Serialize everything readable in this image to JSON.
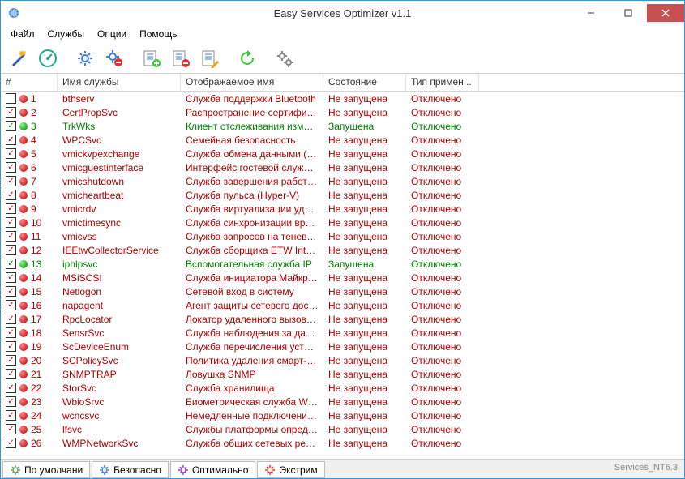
{
  "window": {
    "title": "Easy Services Optimizer v1.1"
  },
  "menu": {
    "file": "Файл",
    "services": "Службы",
    "options": "Опции",
    "help": "Помощь"
  },
  "columns": {
    "num": "#",
    "name": "Имя службы",
    "display": "Отображаемое имя",
    "state": "Состояние",
    "startup": "Тип примен..."
  },
  "tabs": {
    "default": "По умолчани",
    "safe": "Безопасно",
    "optimal": "Оптимально",
    "extreme": "Экстрим"
  },
  "status": {
    "right": "Services_NT6.3"
  },
  "rows": [
    {
      "n": "1",
      "chk": false,
      "dot": "red",
      "name": "bthserv",
      "disp": "Служба поддержки Bluetooth",
      "state": "Не запущена",
      "start": "Отключено",
      "cls": "red-text"
    },
    {
      "n": "2",
      "chk": true,
      "dot": "red",
      "name": "CertPropSvc",
      "disp": "Распространение сертификата",
      "state": "Не запущена",
      "start": "Отключено",
      "cls": "red-text"
    },
    {
      "n": "3",
      "chk": true,
      "dot": "green",
      "name": "TrkWks",
      "disp": "Клиент отслеживания измени...",
      "state": "Запущена",
      "start": "Отключено",
      "cls": "green-text"
    },
    {
      "n": "4",
      "chk": true,
      "dot": "red",
      "name": "WPCSvc",
      "disp": "Семейная безопасность",
      "state": "Не запущена",
      "start": "Отключено",
      "cls": "red-text"
    },
    {
      "n": "5",
      "chk": true,
      "dot": "red",
      "name": "vmickvpexchange",
      "disp": "Служба обмена данными (Hy...",
      "state": "Не запущена",
      "start": "Отключено",
      "cls": "red-text"
    },
    {
      "n": "6",
      "chk": true,
      "dot": "red",
      "name": "vmicguestinterface",
      "disp": "Интерфейс гостевой службы ...",
      "state": "Не запущена",
      "start": "Отключено",
      "cls": "red-text"
    },
    {
      "n": "7",
      "chk": true,
      "dot": "red",
      "name": "vmicshutdown",
      "disp": "Служба завершения работы ...",
      "state": "Не запущена",
      "start": "Отключено",
      "cls": "red-text"
    },
    {
      "n": "8",
      "chk": true,
      "dot": "red",
      "name": "vmicheartbeat",
      "disp": "Служба пульса (Hyper-V)",
      "state": "Не запущена",
      "start": "Отключено",
      "cls": "red-text"
    },
    {
      "n": "9",
      "chk": true,
      "dot": "red",
      "name": "vmicrdv",
      "disp": "Служба виртуализации удал...",
      "state": "Не запущена",
      "start": "Отключено",
      "cls": "red-text"
    },
    {
      "n": "10",
      "chk": true,
      "dot": "red",
      "name": "vmictimesync",
      "disp": "Служба синхронизации време...",
      "state": "Не запущена",
      "start": "Отключено",
      "cls": "red-text"
    },
    {
      "n": "11",
      "chk": true,
      "dot": "red",
      "name": "vmicvss",
      "disp": "Служба запросов на теневое ...",
      "state": "Не запущена",
      "start": "Отключено",
      "cls": "red-text"
    },
    {
      "n": "12",
      "chk": true,
      "dot": "red",
      "name": "IEEtwCollectorService",
      "disp": "Служба сборщика ETW Intern...",
      "state": "Не запущена",
      "start": "Отключено",
      "cls": "red-text"
    },
    {
      "n": "13",
      "chk": true,
      "dot": "green",
      "name": "iphlpsvc",
      "disp": "Вспомогательная служба IP",
      "state": "Запущена",
      "start": "Отключено",
      "cls": "green-text"
    },
    {
      "n": "14",
      "chk": true,
      "dot": "red",
      "name": "MSiSCSI",
      "disp": "Служба инициатора Майкрос...",
      "state": "Не запущена",
      "start": "Отключено",
      "cls": "red-text"
    },
    {
      "n": "15",
      "chk": true,
      "dot": "red",
      "name": "Netlogon",
      "disp": "Сетевой вход в систему",
      "state": "Не запущена",
      "start": "Отключено",
      "cls": "red-text"
    },
    {
      "n": "16",
      "chk": true,
      "dot": "red",
      "name": "napagent",
      "disp": "Агент защиты сетевого дост...",
      "state": "Не запущена",
      "start": "Отключено",
      "cls": "red-text"
    },
    {
      "n": "17",
      "chk": true,
      "dot": "red",
      "name": "RpcLocator",
      "disp": "Локатор удаленного вызова ...",
      "state": "Не запущена",
      "start": "Отключено",
      "cls": "red-text"
    },
    {
      "n": "18",
      "chk": true,
      "dot": "red",
      "name": "SensrSvc",
      "disp": "Служба наблюдения за датч...",
      "state": "Не запущена",
      "start": "Отключено",
      "cls": "red-text"
    },
    {
      "n": "19",
      "chk": true,
      "dot": "red",
      "name": "ScDeviceEnum",
      "disp": "Служба перечисления устрой...",
      "state": "Не запущена",
      "start": "Отключено",
      "cls": "red-text"
    },
    {
      "n": "20",
      "chk": true,
      "dot": "red",
      "name": "SCPolicySvc",
      "disp": "Политика удаления смарт-карт",
      "state": "Не запущена",
      "start": "Отключено",
      "cls": "red-text"
    },
    {
      "n": "21",
      "chk": true,
      "dot": "red",
      "name": "SNMPTRAP",
      "disp": "Ловушка SNMP",
      "state": "Не запущена",
      "start": "Отключено",
      "cls": "red-text"
    },
    {
      "n": "22",
      "chk": true,
      "dot": "red",
      "name": "StorSvc",
      "disp": "Служба хранилища",
      "state": "Не запущена",
      "start": "Отключено",
      "cls": "red-text"
    },
    {
      "n": "23",
      "chk": true,
      "dot": "red",
      "name": "WbioSrvc",
      "disp": "Биометрическая служба Wind...",
      "state": "Не запущена",
      "start": "Отключено",
      "cls": "red-text"
    },
    {
      "n": "24",
      "chk": true,
      "dot": "red",
      "name": "wcncsvc",
      "disp": "Немедленные подключения ...",
      "state": "Не запущена",
      "start": "Отключено",
      "cls": "red-text"
    },
    {
      "n": "25",
      "chk": true,
      "dot": "red",
      "name": "lfsvc",
      "disp": "Службы платформы определ...",
      "state": "Не запущена",
      "start": "Отключено",
      "cls": "red-text"
    },
    {
      "n": "26",
      "chk": true,
      "dot": "red",
      "name": "WMPNetworkSvc",
      "disp": "Служба общих сетевых ресу...",
      "state": "Не запущена",
      "start": "Отключено",
      "cls": "red-text"
    }
  ]
}
